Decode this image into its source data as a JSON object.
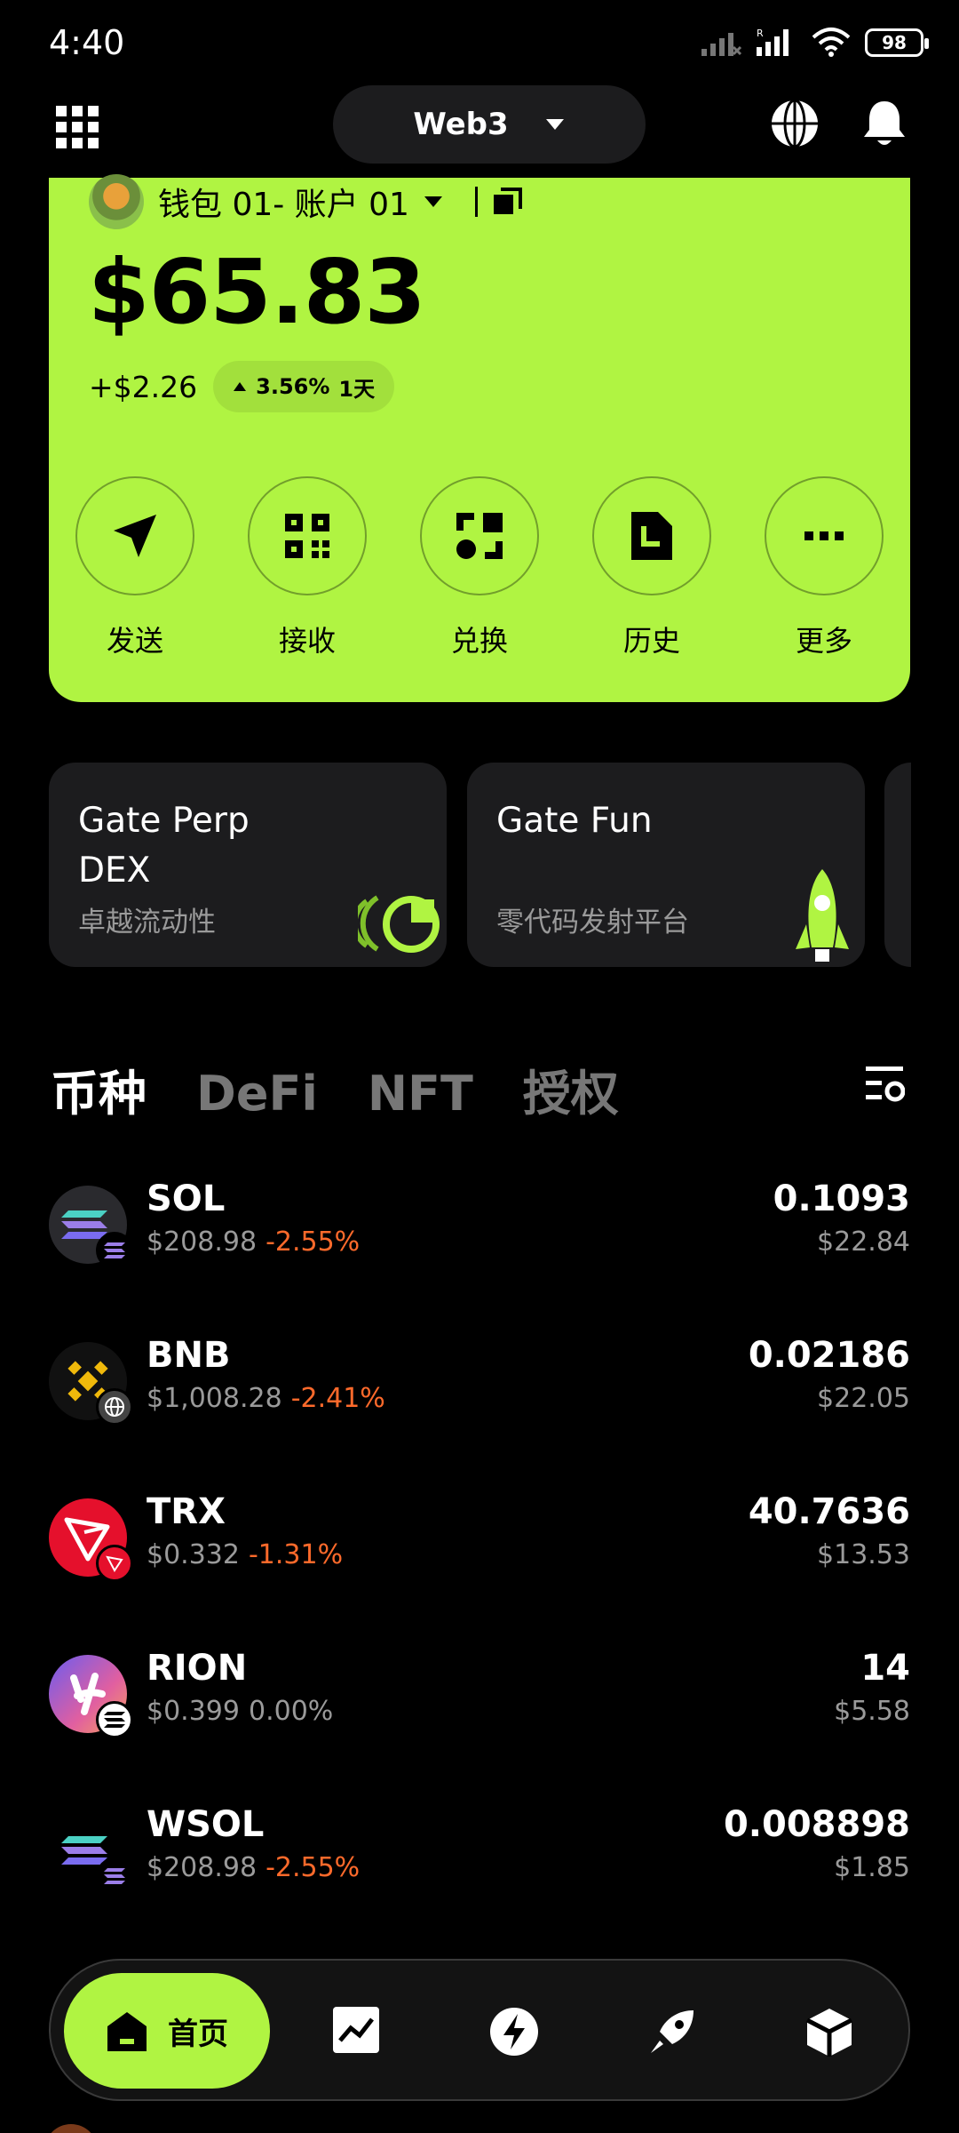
{
  "status_bar": {
    "time": "4:40",
    "battery": "98"
  },
  "header": {
    "network_label": "Web3"
  },
  "wallet": {
    "account_label": "钱包 01- 账户 01",
    "balance": "$65.83",
    "change_amount": "+$2.26",
    "change_percent": "3.56%",
    "change_period": "1天",
    "actions": [
      {
        "label": "发送",
        "icon": "send-icon"
      },
      {
        "label": "接收",
        "icon": "qr-icon"
      },
      {
        "label": "兑换",
        "icon": "swap-icon"
      },
      {
        "label": "历史",
        "icon": "history-icon"
      },
      {
        "label": "更多",
        "icon": "more-icon"
      }
    ]
  },
  "features": [
    {
      "title_line1": "Gate Perp",
      "title_line2": "DEX",
      "subtitle": "卓越流动性"
    },
    {
      "title_line1": "Gate Fun",
      "title_line2": "",
      "subtitle": "零代码发射平台"
    }
  ],
  "tabs": [
    "币种",
    "DeFi",
    "NFT",
    "授权"
  ],
  "tokens": [
    {
      "symbol": "SOL",
      "price": "$208.98",
      "change": "-2.55%",
      "amount": "0.1093",
      "value": "$22.84"
    },
    {
      "symbol": "BNB",
      "price": "$1,008.28",
      "change": "-2.41%",
      "amount": "0.02186",
      "value": "$22.05"
    },
    {
      "symbol": "TRX",
      "price": "$0.332",
      "change": "-1.31%",
      "amount": "40.7636",
      "value": "$13.53"
    },
    {
      "symbol": "RION",
      "price": "$0.399",
      "change": "0.00%",
      "amount": "14",
      "value": "$5.58"
    },
    {
      "symbol": "WSOL",
      "price": "$208.98",
      "change": "-2.55%",
      "amount": "0.008898",
      "value": "$1.85"
    }
  ],
  "bottom_nav": {
    "home_label": "首页"
  },
  "colors": {
    "accent": "#b0f442",
    "negative": "#ff6a2b",
    "card": "#1c1c1e"
  }
}
